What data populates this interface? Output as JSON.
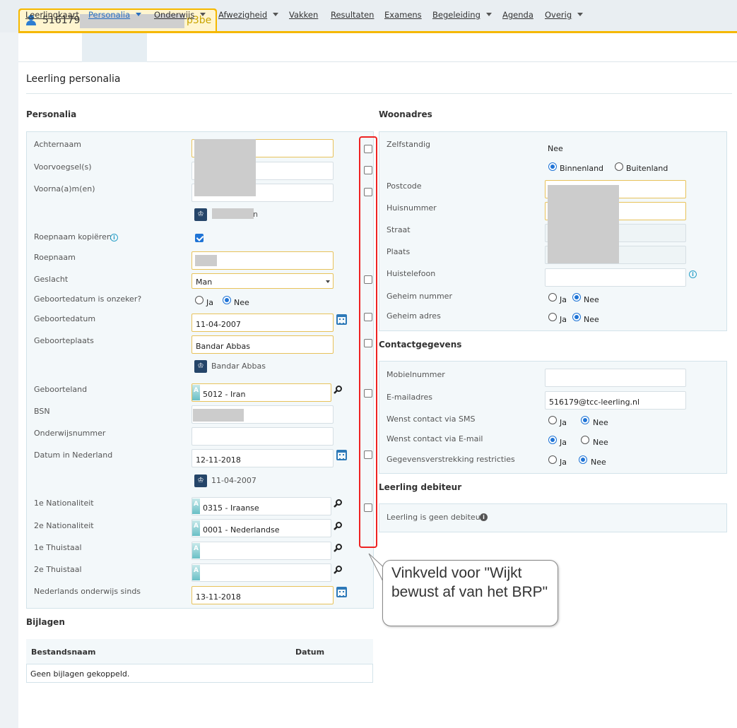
{
  "tab": {
    "number": "516179",
    "suffix": "p3be"
  },
  "nav": {
    "items": [
      {
        "label": "Leerlingkaart",
        "caret": false,
        "active": false
      },
      {
        "label": "Personalia",
        "caret": true,
        "active": true
      },
      {
        "label": "Onderwijs",
        "caret": true,
        "active": false
      },
      {
        "label": "Afwezigheid",
        "caret": true,
        "active": false
      },
      {
        "label": "Vakken",
        "caret": false,
        "active": false
      },
      {
        "label": "Resultaten",
        "caret": false,
        "active": false
      },
      {
        "label": "Examens",
        "caret": false,
        "active": false
      },
      {
        "label": "Begeleiding",
        "caret": true,
        "active": false
      },
      {
        "label": "Agenda",
        "caret": false,
        "active": false
      },
      {
        "label": "Overig",
        "caret": true,
        "active": false
      }
    ]
  },
  "page_title": "Leerling personalia",
  "personalia": {
    "title": "Personalia",
    "achternaam": "Achternaam",
    "voorvoegsel": "Voorvoegsel(s)",
    "voornamen": "Voorna(a)m(en)",
    "name_suffix": "n",
    "roepnaam_kopieren": "Roepnaam kopiëren",
    "roepnaam": "Roepnaam",
    "geslacht": "Geslacht",
    "geslacht_value": "Man",
    "geb_onzeker": "Geboortedatum is onzeker?",
    "geboortedatum": "Geboortedatum",
    "geboortedatum_value": "11-04-2007",
    "geboorteplaats": "Geboorteplaats",
    "geboorteplaats_value": "Bandar Abbas",
    "geboorteplaats_brp": "Bandar Abbas",
    "geboorteland": "Geboorteland",
    "geboorteland_value": "5012 - Iran",
    "bsn": "BSN",
    "onderwijsnummer": "Onderwijsnummer",
    "datum_nl": "Datum in Nederland",
    "datum_nl_value": "12-11-2018",
    "datum_nl_brp": "11-04-2007",
    "nat1": "1e Nationaliteit",
    "nat1_value": "0315 - Iraanse",
    "nat2": "2e Nationaliteit",
    "nat2_value": "0001 - Nederlandse",
    "taal1": "1e Thuistaal",
    "taal2": "2e Thuistaal",
    "nl_onderwijs": "Nederlands onderwijs sinds",
    "nl_onderwijs_value": "13-11-2018"
  },
  "radio": {
    "ja": "Ja",
    "nee": "Nee"
  },
  "woonadres": {
    "title": "Woonadres",
    "zelfstandig": "Zelfstandig",
    "zelfstandig_value": "Nee",
    "binnenland": "Binnenland",
    "buitenland": "Buitenland",
    "postcode": "Postcode",
    "huisnummer": "Huisnummer",
    "straat": "Straat",
    "plaats": "Plaats",
    "huistelefoon": "Huistelefoon",
    "geheim_nummer": "Geheim nummer",
    "geheim_adres": "Geheim adres"
  },
  "contact": {
    "title": "Contactgegevens",
    "mobiel": "Mobielnummer",
    "email": "E-mailadres",
    "email_value": "516179@tcc-leerling.nl",
    "sms": "Wenst contact via SMS",
    "mail": "Wenst contact via E-mail",
    "restricties": "Gegevensverstrekking restricties"
  },
  "debiteur": {
    "title": "Leerling debiteur",
    "text": "Leerling is geen debiteur"
  },
  "bijlagen": {
    "title": "Bijlagen",
    "col_name": "Bestandsnaam",
    "col_date": "Datum",
    "empty": "Geen bijlagen gekoppeld."
  },
  "callout": "Vinkveld voor \"Wijkt bewust af van het BRP\""
}
